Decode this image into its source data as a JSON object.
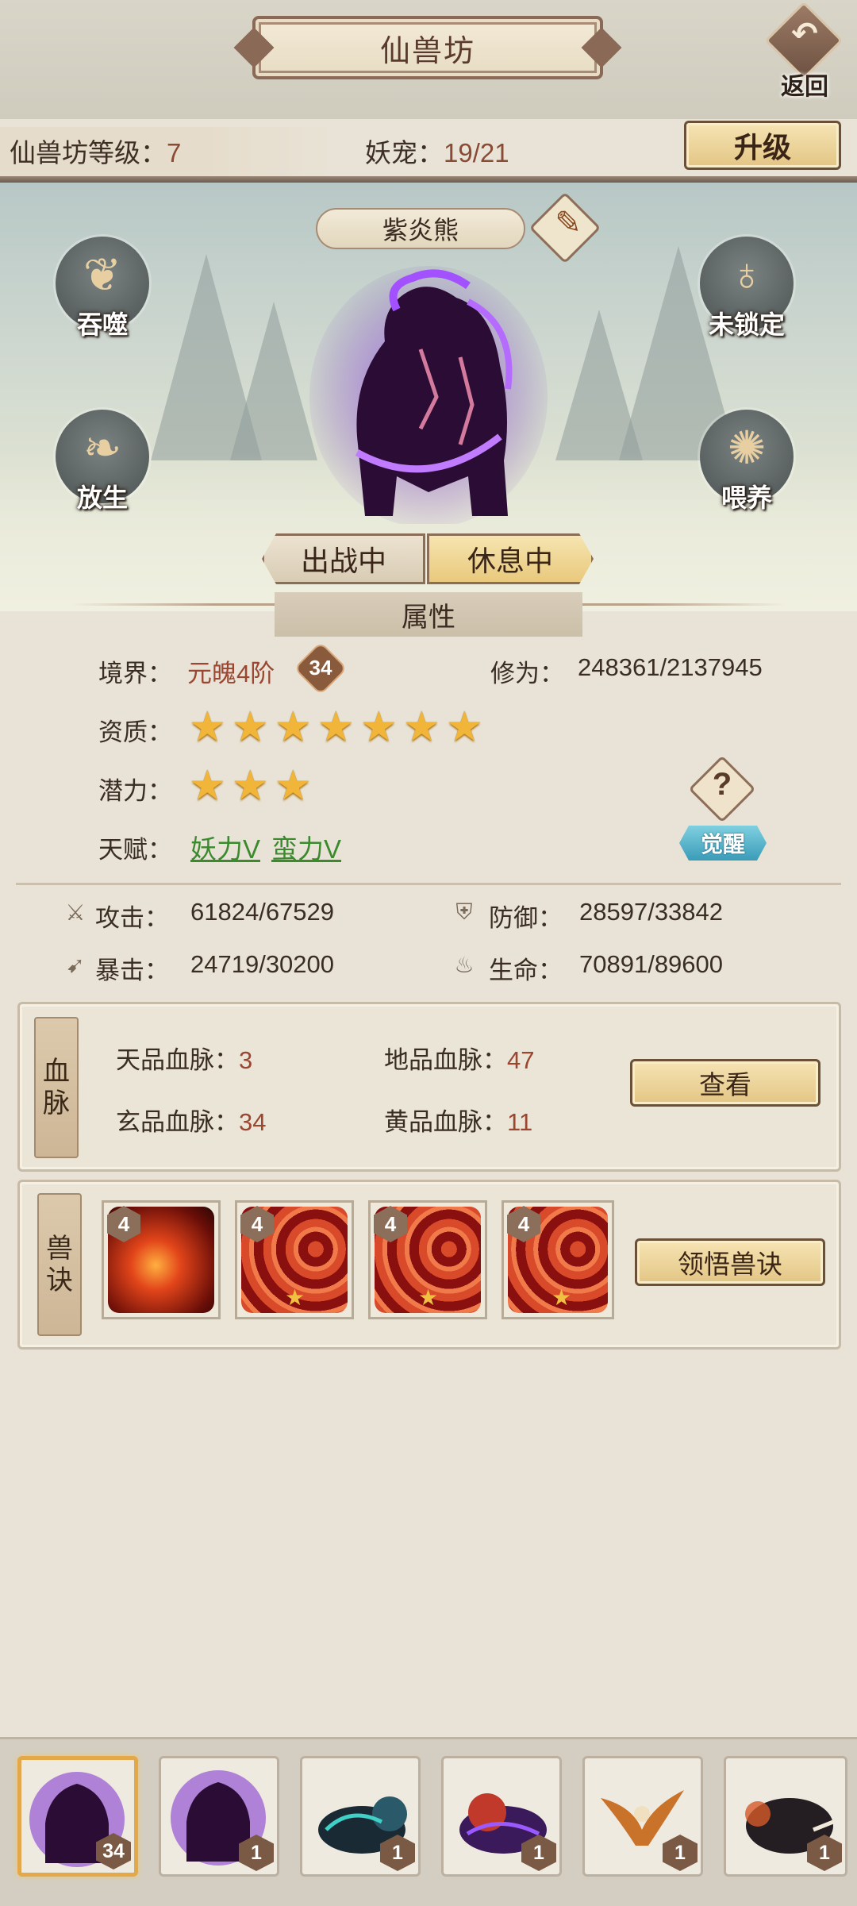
{
  "header": {
    "title": "仙兽坊",
    "back_label": "返回"
  },
  "info_bar": {
    "level_label": "仙兽坊等级：",
    "level_value": "7",
    "pets_label": "妖宠：",
    "pets_value": "19/21",
    "upgrade_label": "升级"
  },
  "pet": {
    "name": "紫炎熊",
    "actions": {
      "devour": "吞噬",
      "lock": "未锁定",
      "release": "放生",
      "feed": "喂养"
    },
    "tabs": {
      "battle": "出战中",
      "rest": "休息中",
      "active": "rest"
    }
  },
  "attributes": {
    "title": "属性",
    "realm_label": "境界：",
    "realm_value": "元魄4阶",
    "realm_level": "34",
    "cultivation_label": "修为：",
    "cultivation_value": "248361/2137945",
    "aptitude_label": "资质：",
    "aptitude_stars": 7,
    "potential_label": "潜力：",
    "potential_stars": 3,
    "talent_label": "天赋：",
    "talents": [
      "妖力V",
      "蛮力V"
    ],
    "help_label": "?",
    "awaken_label": "觉醒"
  },
  "stats": {
    "attack_label": "攻击：",
    "attack_value": "61824/67529",
    "defense_label": "防御：",
    "defense_value": "28597/33842",
    "crit_label": "暴击：",
    "crit_value": "24719/30200",
    "hp_label": "生命：",
    "hp_value": "70891/89600"
  },
  "bloodline": {
    "tag": [
      "血",
      "脉"
    ],
    "heaven_label": "天品血脉：",
    "heaven_value": "3",
    "earth_label": "地品血脉：",
    "earth_value": "47",
    "mystic_label": "玄品血脉：",
    "mystic_value": "34",
    "yellow_label": "黄品血脉：",
    "yellow_value": "11",
    "view_label": "查看"
  },
  "skills": {
    "tag": [
      "兽",
      "诀"
    ],
    "items": [
      {
        "level": "4",
        "type": "fire-fox"
      },
      {
        "level": "4",
        "type": "red-swirl"
      },
      {
        "level": "4",
        "type": "red-swirl"
      },
      {
        "level": "4",
        "type": "red-swirl"
      }
    ],
    "learn_label": "领悟兽诀"
  },
  "pet_list": [
    {
      "level": "34",
      "kind": "purple-bear",
      "selected": true
    },
    {
      "level": "1",
      "kind": "purple-bear"
    },
    {
      "level": "1",
      "kind": "teal-lion"
    },
    {
      "level": "1",
      "kind": "purple-lion"
    },
    {
      "level": "1",
      "kind": "fire-eagle"
    },
    {
      "level": "1",
      "kind": "black-boar"
    }
  ],
  "colors": {
    "accent_gold": "#e9c97c",
    "value_red": "#9a4630",
    "talent_green": "#3b8a2e",
    "awaken_blue": "#3a9cb8"
  }
}
